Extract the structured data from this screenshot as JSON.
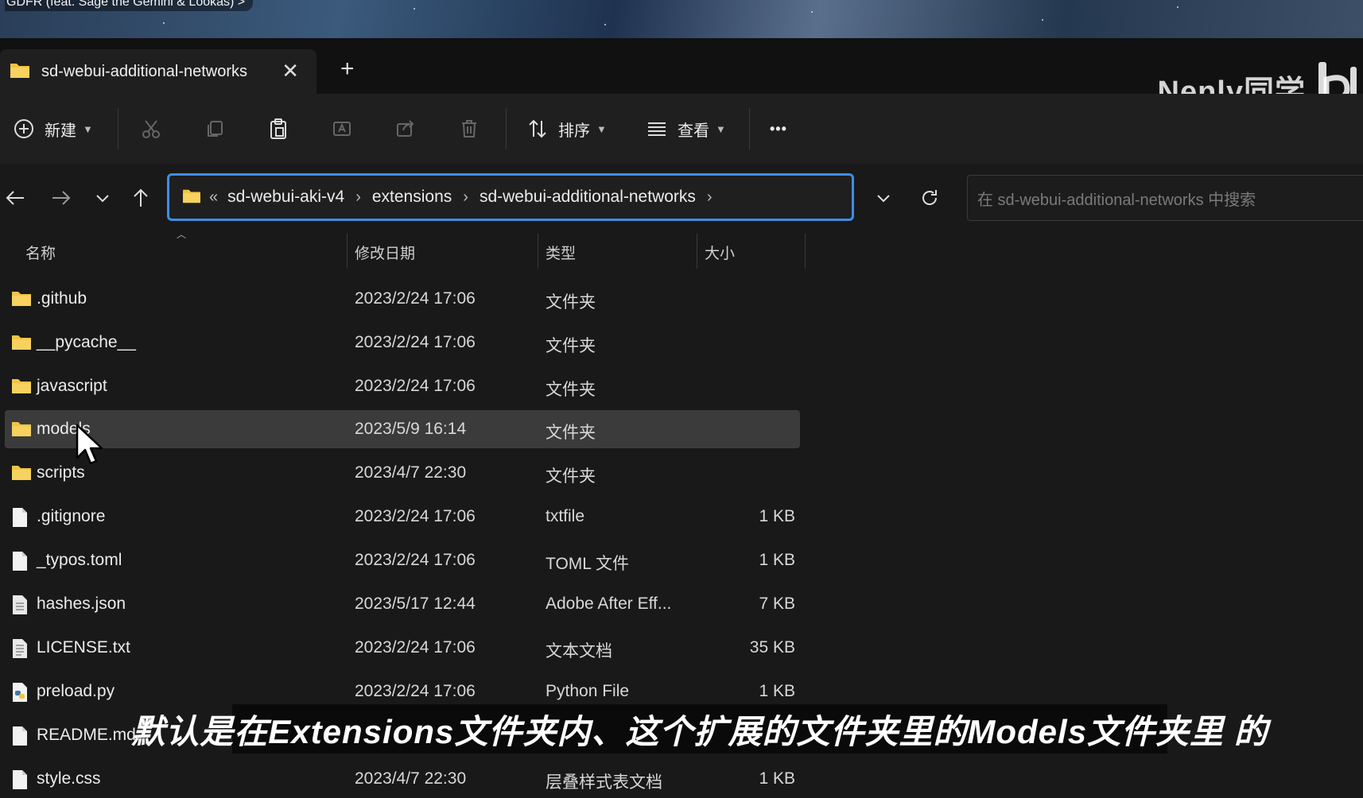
{
  "banner": {
    "now_playing": "GDFR (feat. Sage the Gemini & Lookas) >"
  },
  "watermark": {
    "text": "Nenly同学"
  },
  "tab": {
    "title": "sd-webui-additional-networks",
    "close_glyph": "✕",
    "add_glyph": "+"
  },
  "toolbar": {
    "new_label": "新建",
    "sort_label": "排序",
    "view_label": "查看",
    "more_glyph": "•••"
  },
  "address": {
    "overflow_glyph": "«",
    "crumbs": [
      "sd-webui-aki-v4",
      "extensions",
      "sd-webui-additional-networks"
    ],
    "sep_glyph": "›"
  },
  "search": {
    "placeholder": "在 sd-webui-additional-networks 中搜索"
  },
  "columns": {
    "name": "名称",
    "date": "修改日期",
    "type": "类型",
    "size": "大小"
  },
  "files": [
    {
      "name": ".github",
      "date": "2023/2/24 17:06",
      "type": "文件夹",
      "size": "",
      "icon": "folder-icon"
    },
    {
      "name": "__pycache__",
      "date": "2023/2/24 17:06",
      "type": "文件夹",
      "size": "",
      "icon": "folder-icon"
    },
    {
      "name": "javascript",
      "date": "2023/2/24 17:06",
      "type": "文件夹",
      "size": "",
      "icon": "folder-icon"
    },
    {
      "name": "models",
      "date": "2023/5/9 16:14",
      "type": "文件夹",
      "size": "",
      "icon": "folder-icon",
      "selected": true
    },
    {
      "name": "scripts",
      "date": "2023/4/7 22:30",
      "type": "文件夹",
      "size": "",
      "icon": "folder-icon"
    },
    {
      "name": ".gitignore",
      "date": "2023/2/24 17:06",
      "type": "txtfile",
      "size": "1 KB",
      "icon": "file-icon"
    },
    {
      "name": "_typos.toml",
      "date": "2023/2/24 17:06",
      "type": "TOML 文件",
      "size": "1 KB",
      "icon": "file-icon"
    },
    {
      "name": "hashes.json",
      "date": "2023/5/17 12:44",
      "type": "Adobe After Eff...",
      "size": "7 KB",
      "icon": "document-icon"
    },
    {
      "name": "LICENSE.txt",
      "date": "2023/2/24 17:06",
      "type": "文本文档",
      "size": "35 KB",
      "icon": "text-file-icon"
    },
    {
      "name": "preload.py",
      "date": "2023/2/24 17:06",
      "type": "Python File",
      "size": "1 KB",
      "icon": "python-file-icon"
    },
    {
      "name": "README.md",
      "date": "",
      "type": "",
      "size": "",
      "icon": "file-icon"
    },
    {
      "name": "style.css",
      "date": "2023/4/7 22:30",
      "type": "层叠样式表文档",
      "size": "1 KB",
      "icon": "file-icon"
    }
  ],
  "subtitle": {
    "text": "默认是在Extensions文件夹内、这个扩展的文件夹里的Models文件夹里 的"
  },
  "colors": {
    "accent": "#3d8ee6",
    "folder": "#f3c344",
    "background": "#191919",
    "selection": "#3b3b3b"
  }
}
